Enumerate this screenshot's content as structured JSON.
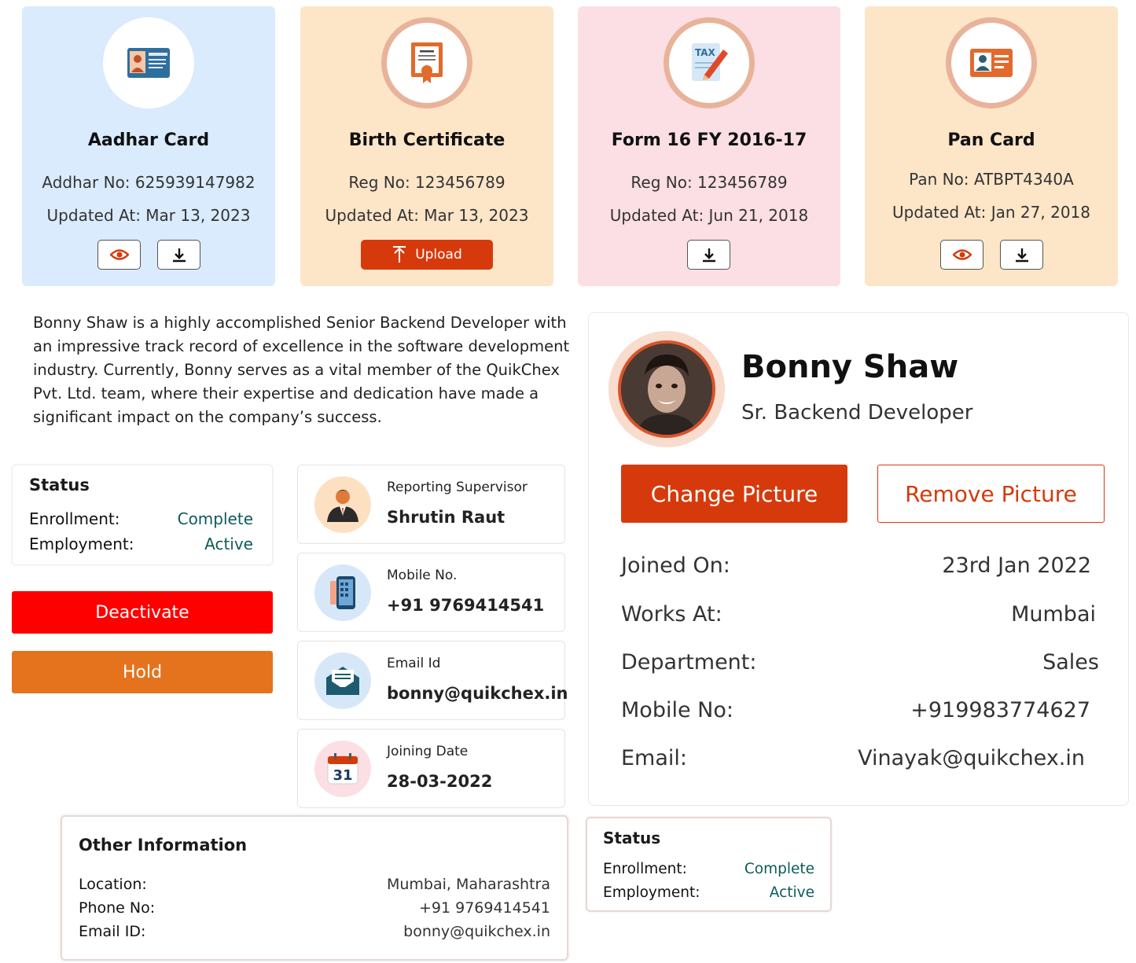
{
  "documents": [
    {
      "title": "Aadhar Card",
      "line1": "Addhar No: 625939147982",
      "line2": "Updated At: Mar 13, 2023",
      "bg": "#d9ebfc"
    },
    {
      "title": "Birth Certificate",
      "line1": "Reg No: 123456789",
      "line2": "Updated At: Mar 13, 2023",
      "bg": "#fde5c8",
      "upload_label": "Upload"
    },
    {
      "title": "Form 16 FY 2016-17",
      "line1": "Reg No: 123456789",
      "line2": "Updated At: Jun 21, 2018",
      "bg": "#fbdfe4",
      "icon_text": "TAX"
    },
    {
      "title": "Pan Card",
      "line1": "Pan No: ATBPT4340A",
      "line2": "Updated At: Jan 27, 2018",
      "bg": "#fde5c8"
    }
  ],
  "bio": "Bonny Shaw is a highly accomplished Senior Backend Developer with an impressive track record of excellence in the software development industry. Currently, Bonny serves as a vital member of the QuikChex Pvt. Ltd. team, where their expertise and dedication have made a significant impact on the company’s success.",
  "status": {
    "title": "Status",
    "enrollment_label": "Enrollment:",
    "enrollment_value": "Complete",
    "employment_label": "Employment:",
    "employment_value": "Active"
  },
  "actions": {
    "deactivate": "Deactivate",
    "hold": "Hold"
  },
  "tiles": [
    {
      "label": "Reporting Supervisor",
      "value": "Shrutin Raut"
    },
    {
      "label": "Mobile No.",
      "value": "+91 9769414541"
    },
    {
      "label": "Email Id",
      "value": "bonny@quikchex.in"
    },
    {
      "label": "Joining Date",
      "value": "28-03-2022",
      "calendar_day": "31"
    }
  ],
  "profile": {
    "name": "Bonny Shaw",
    "role": "Sr. Backend Developer",
    "change_label": "Change Picture",
    "remove_label": "Remove Picture",
    "rows": [
      {
        "label": "Joined On:",
        "value": "23rd Jan 2022"
      },
      {
        "label": "Works At:",
        "value": "Mumbai"
      },
      {
        "label": "Department:",
        "value": "Sales"
      },
      {
        "label": "Mobile No:",
        "value": "+919983774627"
      },
      {
        "label": "Email:",
        "value": "Vinayak@quikchex.in"
      }
    ]
  },
  "other_info": {
    "title": "Other Information",
    "rows": [
      {
        "label": "Location:",
        "value": "Mumbai, Maharashtra"
      },
      {
        "label": "Phone No:",
        "value": "+91 9769414541"
      },
      {
        "label": "Email ID:",
        "value": "bonny@quikchex.in"
      }
    ]
  },
  "colors": {
    "accent": "#d63a0c",
    "deactivate": "#ff0000",
    "hold": "#e5731e",
    "status_value": "#0e5a5a"
  }
}
